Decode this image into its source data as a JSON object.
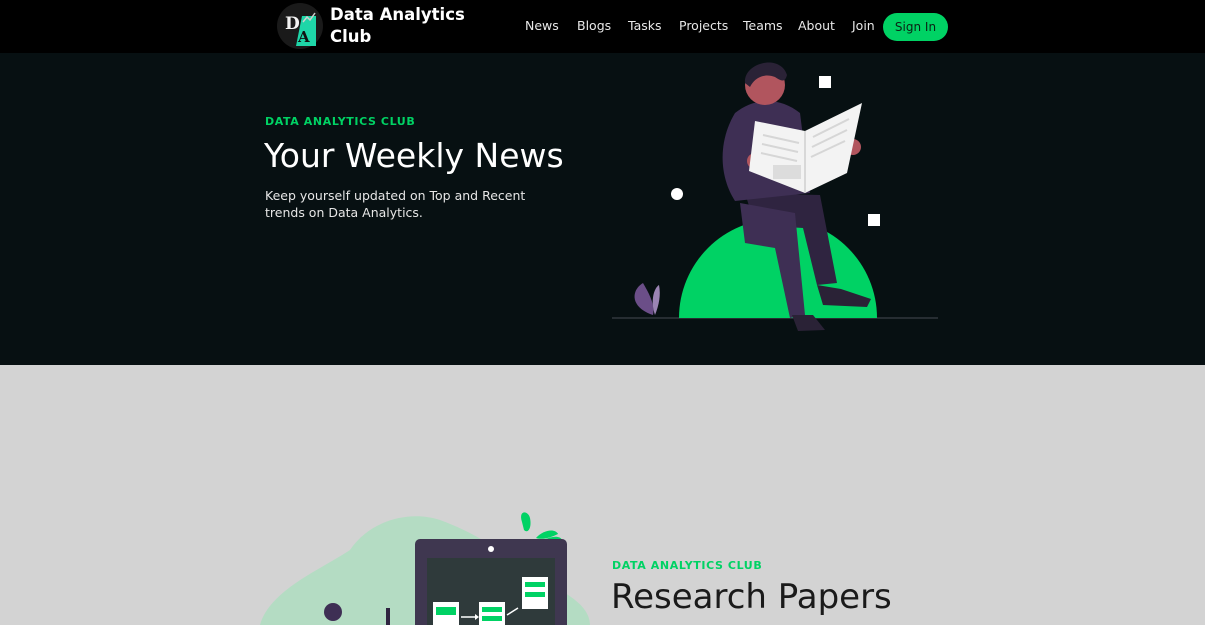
{
  "navbar": {
    "brand_name": "Data Analytics Club",
    "logo_letters": "DA",
    "links": [
      "News",
      "Blogs",
      "Tasks",
      "Projects",
      "Teams",
      "About",
      "Join"
    ],
    "signin_label": "Sign In"
  },
  "hero": {
    "eyebrow": "DATA ANALYTICS CLUB",
    "title": "Your Weekly News",
    "description": "Keep yourself updated on Top and Recent trends on Data Analytics."
  },
  "section2": {
    "eyebrow": "DATA ANALYTICS CLUB",
    "title": "Research Papers"
  },
  "colors": {
    "accent": "#00d264",
    "nav_bg": "#000000",
    "hero_bg": "#071012",
    "section_bg": "#d3d3d3"
  }
}
